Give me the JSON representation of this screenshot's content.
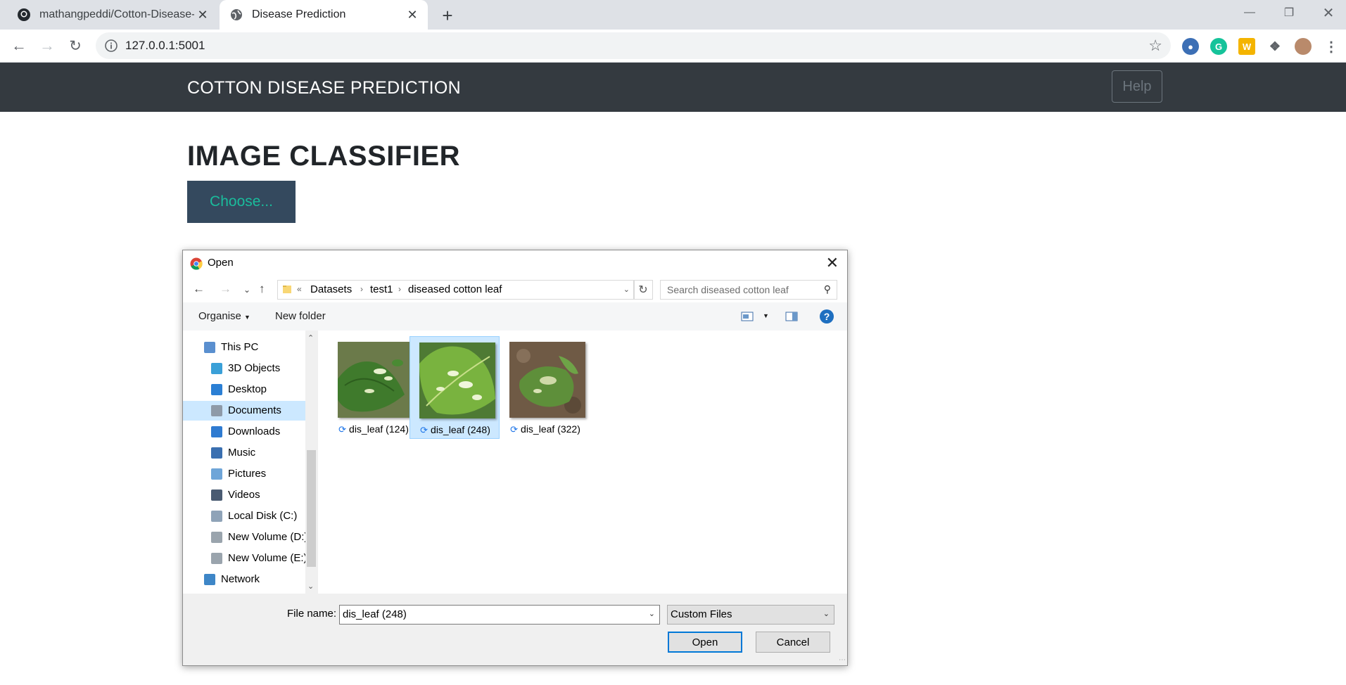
{
  "browser": {
    "tabs": [
      {
        "title": "mathangpeddi/Cotton-Disease-P",
        "close": "✕"
      },
      {
        "title": "Disease Prediction",
        "close": "✕"
      }
    ],
    "newtab": "+",
    "url": "127.0.0.1:5001"
  },
  "page": {
    "brand": "COTTON DISEASE PREDICTION",
    "help": "Help",
    "heading": "IMAGE CLASSIFIER",
    "choose": "Choose..."
  },
  "dialog": {
    "title": "Open",
    "breadcrumb": [
      "Datasets",
      "test1",
      "diseased cotton leaf"
    ],
    "search_placeholder": "Search diseased cotton leaf",
    "organise": "Organise",
    "new_folder": "New folder",
    "nav": [
      {
        "label": "This PC",
        "icon": "pc-icon"
      },
      {
        "label": "3D Objects",
        "icon": "3d-objects-icon"
      },
      {
        "label": "Desktop",
        "icon": "desktop-icon"
      },
      {
        "label": "Documents",
        "icon": "documents-icon",
        "selected": true
      },
      {
        "label": "Downloads",
        "icon": "downloads-icon"
      },
      {
        "label": "Music",
        "icon": "music-icon"
      },
      {
        "label": "Pictures",
        "icon": "pictures-icon"
      },
      {
        "label": "Videos",
        "icon": "videos-icon"
      },
      {
        "label": "Local Disk (C:)",
        "icon": "local-disk-icon"
      },
      {
        "label": "New Volume (D:)",
        "icon": "drive-icon"
      },
      {
        "label": "New Volume (E:)",
        "icon": "drive-icon"
      },
      {
        "label": "Network",
        "icon": "network-icon"
      }
    ],
    "files": [
      {
        "name": "dis_leaf (124)",
        "selected": false
      },
      {
        "name": "dis_leaf (248)",
        "selected": true
      },
      {
        "name": "dis_leaf (322)",
        "selected": false
      }
    ],
    "file_name_label": "File name:",
    "file_name_value": "dis_leaf (248)",
    "file_type": "Custom Files",
    "open": "Open",
    "cancel": "Cancel"
  }
}
